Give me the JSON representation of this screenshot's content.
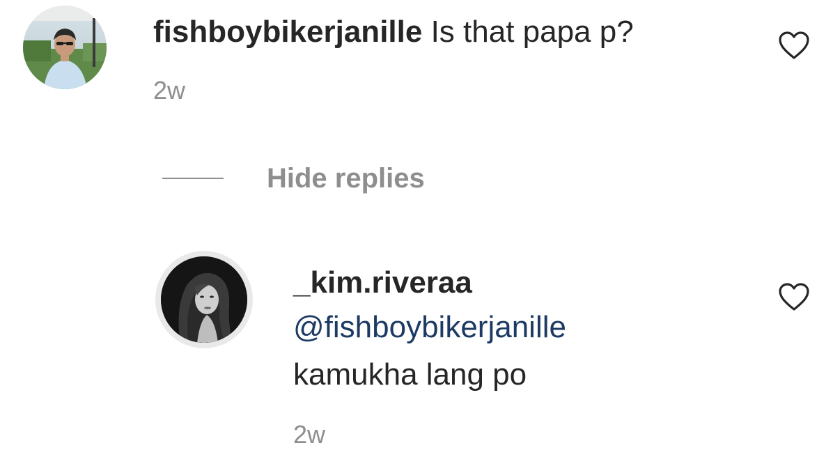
{
  "comment": {
    "username": "fishboybikerjanille",
    "text": "Is that papa p?",
    "time": "2w",
    "avatar_icon": "profile-photo-golfer",
    "like_icon": "heart-outline-icon"
  },
  "replies_toggle": {
    "label": "Hide replies"
  },
  "reply": {
    "username": "_kim.riveraa",
    "mention": "@fishboybikerjanille",
    "text": "kamukha lang po",
    "time": "2w",
    "avatar_icon": "profile-photo-woman-bw",
    "like_icon": "heart-outline-icon"
  },
  "colors": {
    "text": "#262626",
    "muted": "#8e8e8e",
    "mention": "#1c3a63"
  }
}
